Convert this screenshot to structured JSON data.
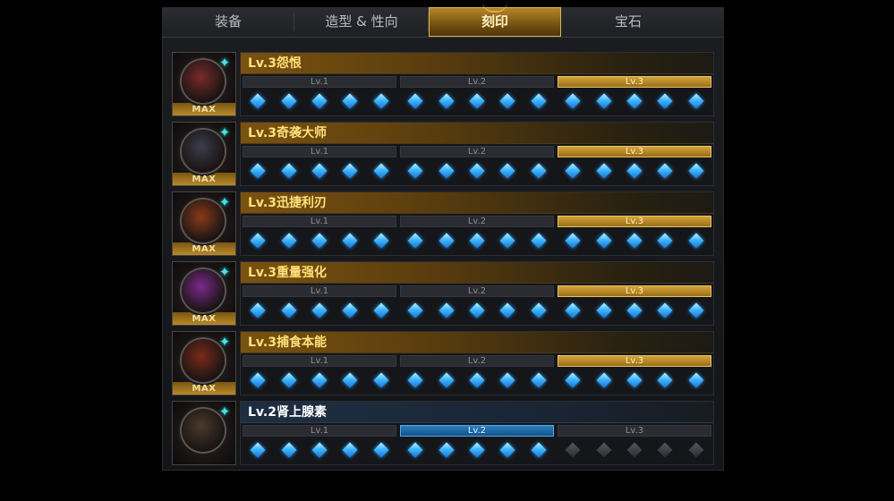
{
  "tabs": [
    {
      "label": "装备",
      "active": false
    },
    {
      "label": "造型 & 性向",
      "active": false
    },
    {
      "label": "刻印",
      "active": true
    },
    {
      "label": "宝石",
      "active": false
    }
  ],
  "level_labels": [
    "Lv.1",
    "Lv.2",
    "Lv.3"
  ],
  "max_label": "MAX",
  "engravings": [
    {
      "title": "Lv.3怨恨",
      "max": true,
      "active_level": 3,
      "filled_gems": 15,
      "portrait_color": "#7a2a2a"
    },
    {
      "title": "Lv.3奇袭大师",
      "max": true,
      "active_level": 3,
      "filled_gems": 15,
      "portrait_color": "#3a3d4a"
    },
    {
      "title": "Lv.3迅捷利刃",
      "max": true,
      "active_level": 3,
      "filled_gems": 15,
      "portrait_color": "#8a3a1a"
    },
    {
      "title": "Lv.3重量强化",
      "max": true,
      "active_level": 3,
      "filled_gems": 15,
      "portrait_color": "#7a2a8a"
    },
    {
      "title": "Lv.3捕食本能",
      "max": true,
      "active_level": 3,
      "filled_gems": 15,
      "portrait_color": "#7a2a1a"
    },
    {
      "title": "Lv.2肾上腺素",
      "max": false,
      "active_level": 2,
      "filled_gems": 10,
      "portrait_color": "#4a3a2a"
    }
  ],
  "colors": {
    "gold": "#d3a33a",
    "blue": "#2a7fc0",
    "gem": "#3fb6ff",
    "star": "#49e1e5"
  }
}
